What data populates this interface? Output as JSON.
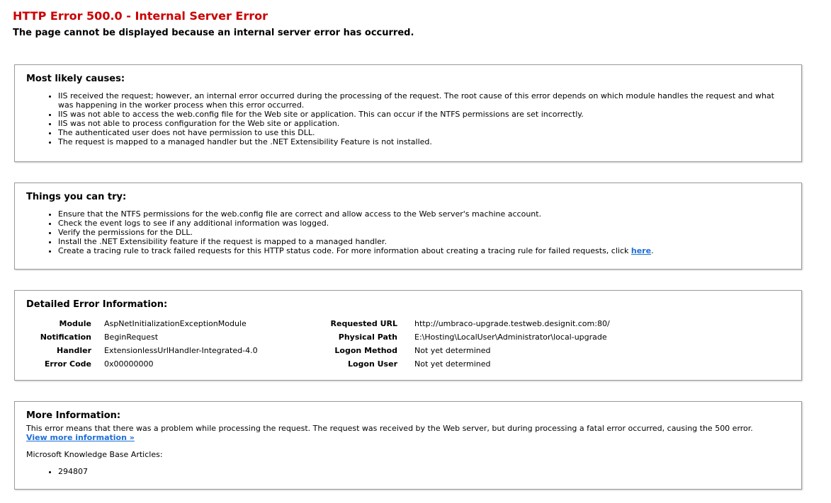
{
  "title": "HTTP Error 500.0 - Internal Server Error",
  "subtitle": "The page cannot be displayed because an internal server error has occurred.",
  "causes": {
    "heading": "Most likely causes:",
    "items": [
      "IIS received the request; however, an internal error occurred during the processing of the request. The root cause of this error depends on which module handles the request and what was happening in the worker process when this error occurred.",
      "IIS was not able to access the web.config file for the Web site or application. This can occur if the NTFS permissions are set incorrectly.",
      "IIS was not able to process configuration for the Web site or application.",
      "The authenticated user does not have permission to use this DLL.",
      "The request is mapped to a managed handler but the .NET Extensibility Feature is not installed."
    ]
  },
  "try": {
    "heading": "Things you can try:",
    "items": [
      "Ensure that the NTFS permissions for the web.config file are correct and allow access to the Web server's machine account.",
      "Check the event logs to see if any additional information was logged.",
      "Verify the permissions for the DLL.",
      "Install the .NET Extensibility feature if the request is mapped to a managed handler."
    ],
    "last_item_text": "Create a tracing rule to track failed requests for this HTTP status code. For more information about creating a tracing rule for failed requests, click ",
    "last_item_link": "here",
    "last_item_suffix": "."
  },
  "details": {
    "heading": "Detailed Error Information:",
    "left": [
      {
        "label": "Module",
        "value": "AspNetInitializationExceptionModule"
      },
      {
        "label": "Notification",
        "value": "BeginRequest"
      },
      {
        "label": "Handler",
        "value": "ExtensionlessUrlHandler-Integrated-4.0"
      },
      {
        "label": "Error Code",
        "value": "0x00000000"
      }
    ],
    "right": [
      {
        "label": "Requested URL",
        "value": "http://umbraco-upgrade.testweb.designit.com:80/"
      },
      {
        "label": "Physical Path",
        "value": "E:\\Hosting\\LocalUser\\Administrator\\local-upgrade"
      },
      {
        "label": "Logon Method",
        "value": "Not yet determined"
      },
      {
        "label": "Logon User",
        "value": "Not yet determined"
      }
    ]
  },
  "more": {
    "heading": "More Information:",
    "text": "This error means that there was a problem while processing the request. The request was received by the Web server, but during processing a fatal error occurred, causing the 500 error.",
    "link": "View more information »",
    "kb_title": "Microsoft Knowledge Base Articles:",
    "kb_items": [
      "294807"
    ]
  }
}
